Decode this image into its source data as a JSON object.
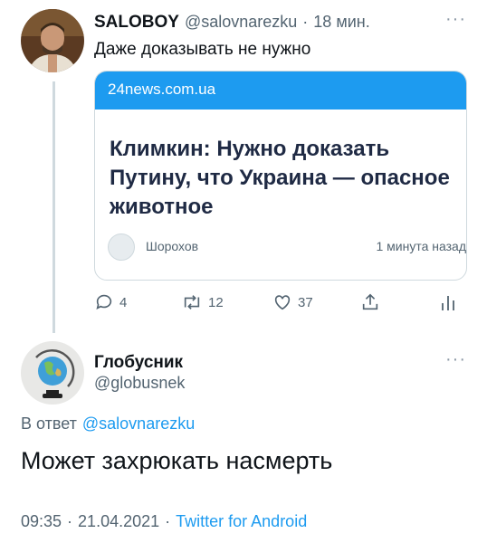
{
  "tweet": {
    "display_name": "SALOBOY",
    "handle": "@salovnarezku",
    "separator": "·",
    "time_ago": "18 мин.",
    "text": "Даже доказывать не нужно",
    "card": {
      "domain": "24news.com.ua",
      "headline": "Климкин: Нужно доказать Путину, что Украина — опасное животное",
      "author": "Шорохов",
      "time": "1 минута назад"
    },
    "actions": {
      "replies": "4",
      "retweets": "12",
      "likes": "37"
    }
  },
  "reply": {
    "display_name": "Глобусник",
    "handle": "@globusnek",
    "reply_to_prefix": "В ответ",
    "reply_to_handle": "@salovnarezku",
    "text": "Может захрюкать насмерть",
    "time": "09:35",
    "date": "21.04.2021",
    "source": "Twitter for Android",
    "dot": "·"
  },
  "more_label": "···",
  "colors": {
    "accent": "#1d9bf0",
    "muted": "#536471",
    "card_header": "#1d9bf0"
  },
  "icons": [
    "reply-icon",
    "retweet-icon",
    "like-icon",
    "share-icon",
    "analytics-icon",
    "more-icon"
  ]
}
